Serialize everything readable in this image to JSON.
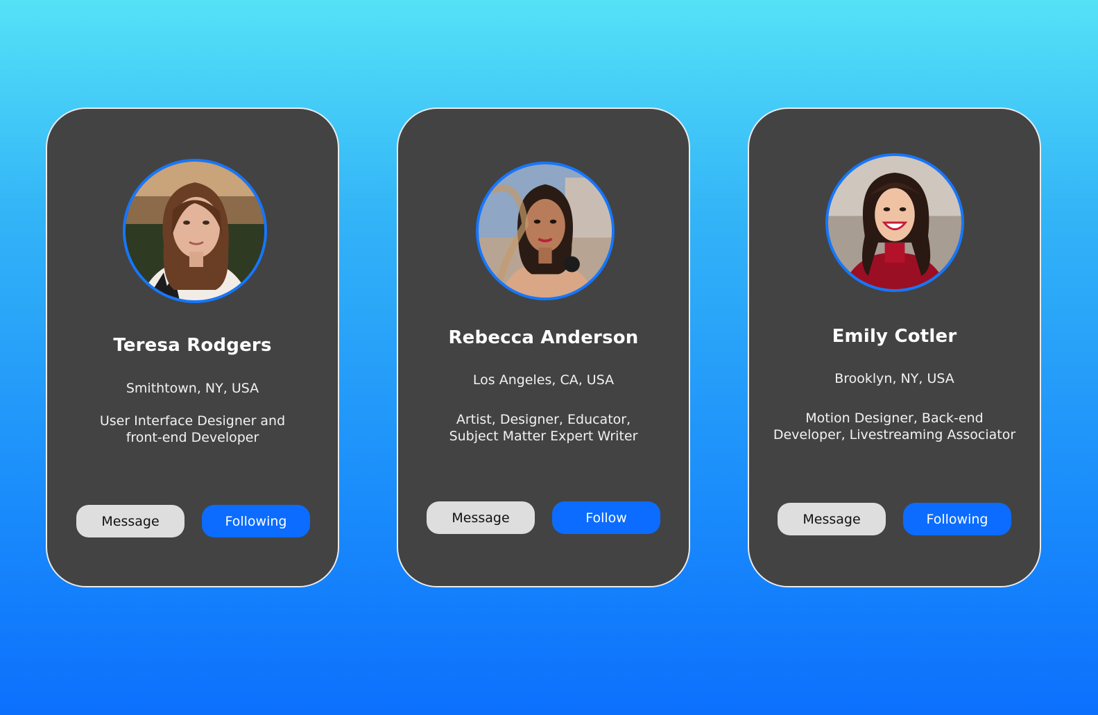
{
  "colors": {
    "card_background": "#434343",
    "card_border": "#ececec",
    "accent_blue": "#0b6cff",
    "avatar_ring": "#1577ff",
    "message_button": "#dedede"
  },
  "cards": [
    {
      "name": "Teresa Rodgers",
      "location": "Smithtown, NY, USA",
      "bio_line1": "User Interface Designer and",
      "bio_line2": "front-end Developer",
      "message_label": "Message",
      "follow_label": "Following",
      "avatar_icon": "profile-photo"
    },
    {
      "name": "Rebecca Anderson",
      "location": "Los Angeles, CA, USA",
      "bio_line1": "Artist, Designer, Educator,",
      "bio_line2": "Subject Matter Expert Writer",
      "message_label": "Message",
      "follow_label": "Follow",
      "avatar_icon": "profile-photo"
    },
    {
      "name": "Emily Cotler",
      "location": "Brooklyn, NY, USA",
      "bio_line1": "Motion Designer, Back-end",
      "bio_line2": "Developer, Livestreaming Associator",
      "message_label": "Message",
      "follow_label": "Following",
      "avatar_icon": "profile-photo"
    }
  ]
}
